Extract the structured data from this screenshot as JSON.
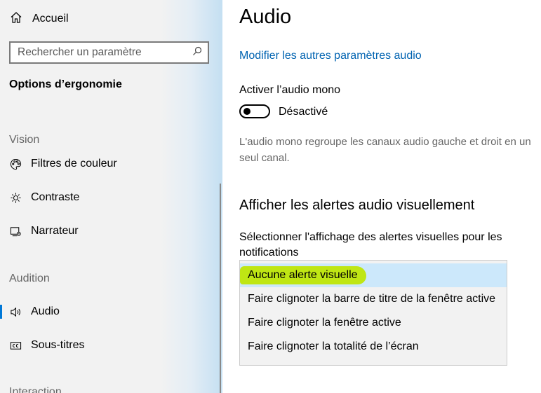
{
  "sidebar": {
    "home_label": "Accueil",
    "search_placeholder": "Rechercher un paramètre",
    "section_title": "Options d’ergonomie",
    "groups": {
      "vision": "Vision",
      "audition": "Audition",
      "interaction": "Interaction"
    },
    "items": {
      "color_filters": "Filtres de couleur",
      "contrast": "Contraste",
      "narrator": "Narrateur",
      "audio": "Audio",
      "subtitles": "Sous-titres"
    }
  },
  "main": {
    "title": "Audio",
    "link_other_audio": "Modifier les autres paramètres audio",
    "mono_audio": {
      "label": "Activer l’audio mono",
      "state": "Désactivé",
      "description": "L'audio mono regroupe les canaux audio gauche et droit en un seul canal."
    },
    "visual_alerts": {
      "heading": "Afficher les alertes audio visuellement",
      "select_label": "Sélectionner l'affichage des alertes visuelles pour les notifications",
      "options": [
        "Aucune alerte visuelle",
        "Faire clignoter la barre de titre de la fenêtre active",
        "Faire clignoter la fenêtre active",
        "Faire clignoter la totalité de l’écran"
      ]
    }
  },
  "colors": {
    "accent": "#0078d7",
    "link": "#0063b1",
    "selected_option": "#cce8fb",
    "highlight": "#bfe614"
  }
}
